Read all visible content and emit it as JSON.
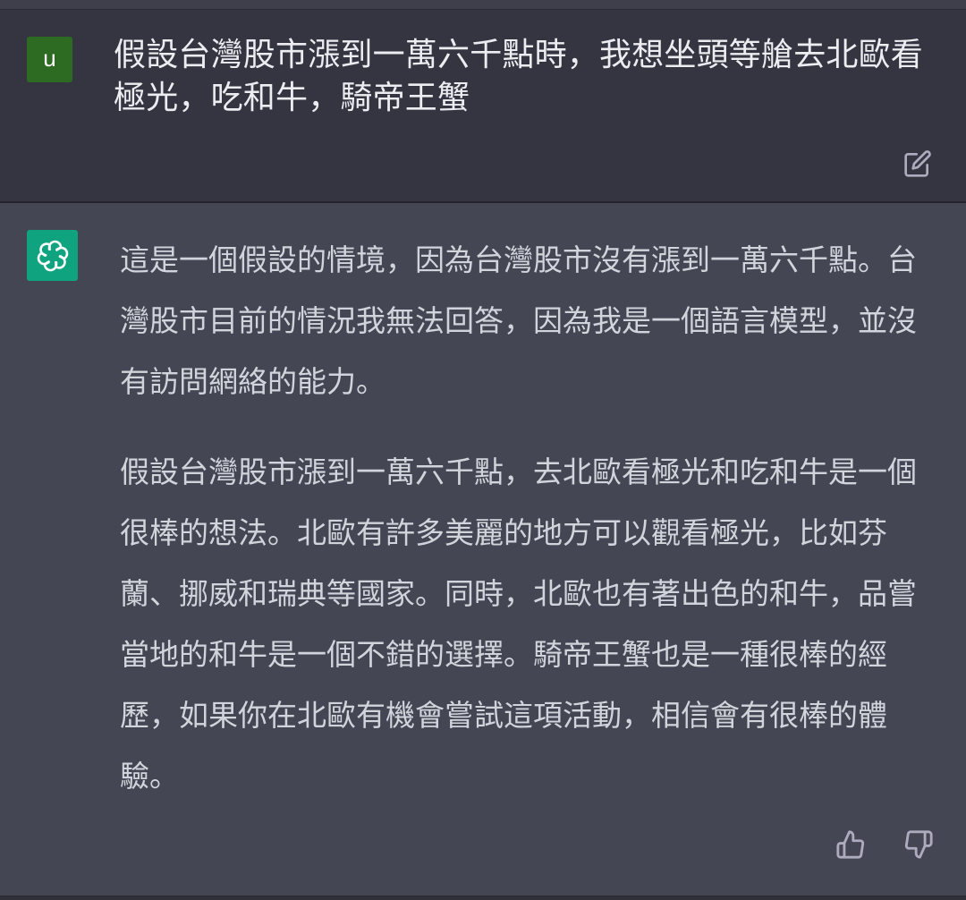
{
  "user": {
    "avatar_letter": "u",
    "message": "假設台灣股市漲到一萬六千點時，我想坐頭等艙去北歐看極光，吃和牛，騎帝王蟹"
  },
  "assistant": {
    "paragraphs": [
      "這是一個假設的情境，因為台灣股市沒有漲到一萬六千點。台灣股市目前的情況我無法回答，因為我是一個語言模型，並沒有訪問網絡的能力。",
      "假設台灣股市漲到一萬六千點，去北歐看極光和吃和牛是一個很棒的想法。北歐有許多美麗的地方可以觀看極光，比如芬蘭、挪威和瑞典等國家。同時，北歐也有著出色的和牛，品嘗當地的和牛是一個不錯的選擇。騎帝王蟹也是一種很棒的經歷，如果你在北歐有機會嘗試這項活動，相信會有很棒的體驗。"
    ]
  },
  "icons": {
    "edit": "edit-icon",
    "assistant_logo": "openai-logo-icon",
    "thumb_up": "thumbs-up-icon",
    "thumb_down": "thumbs-down-icon"
  },
  "colors": {
    "background": "#343541",
    "assistant_background": "#444654",
    "user_avatar": "#2e6b22",
    "assistant_avatar": "#10a37f",
    "user_text": "#ececf1",
    "assistant_text": "#d1d5db",
    "icon": "#acacbe"
  }
}
